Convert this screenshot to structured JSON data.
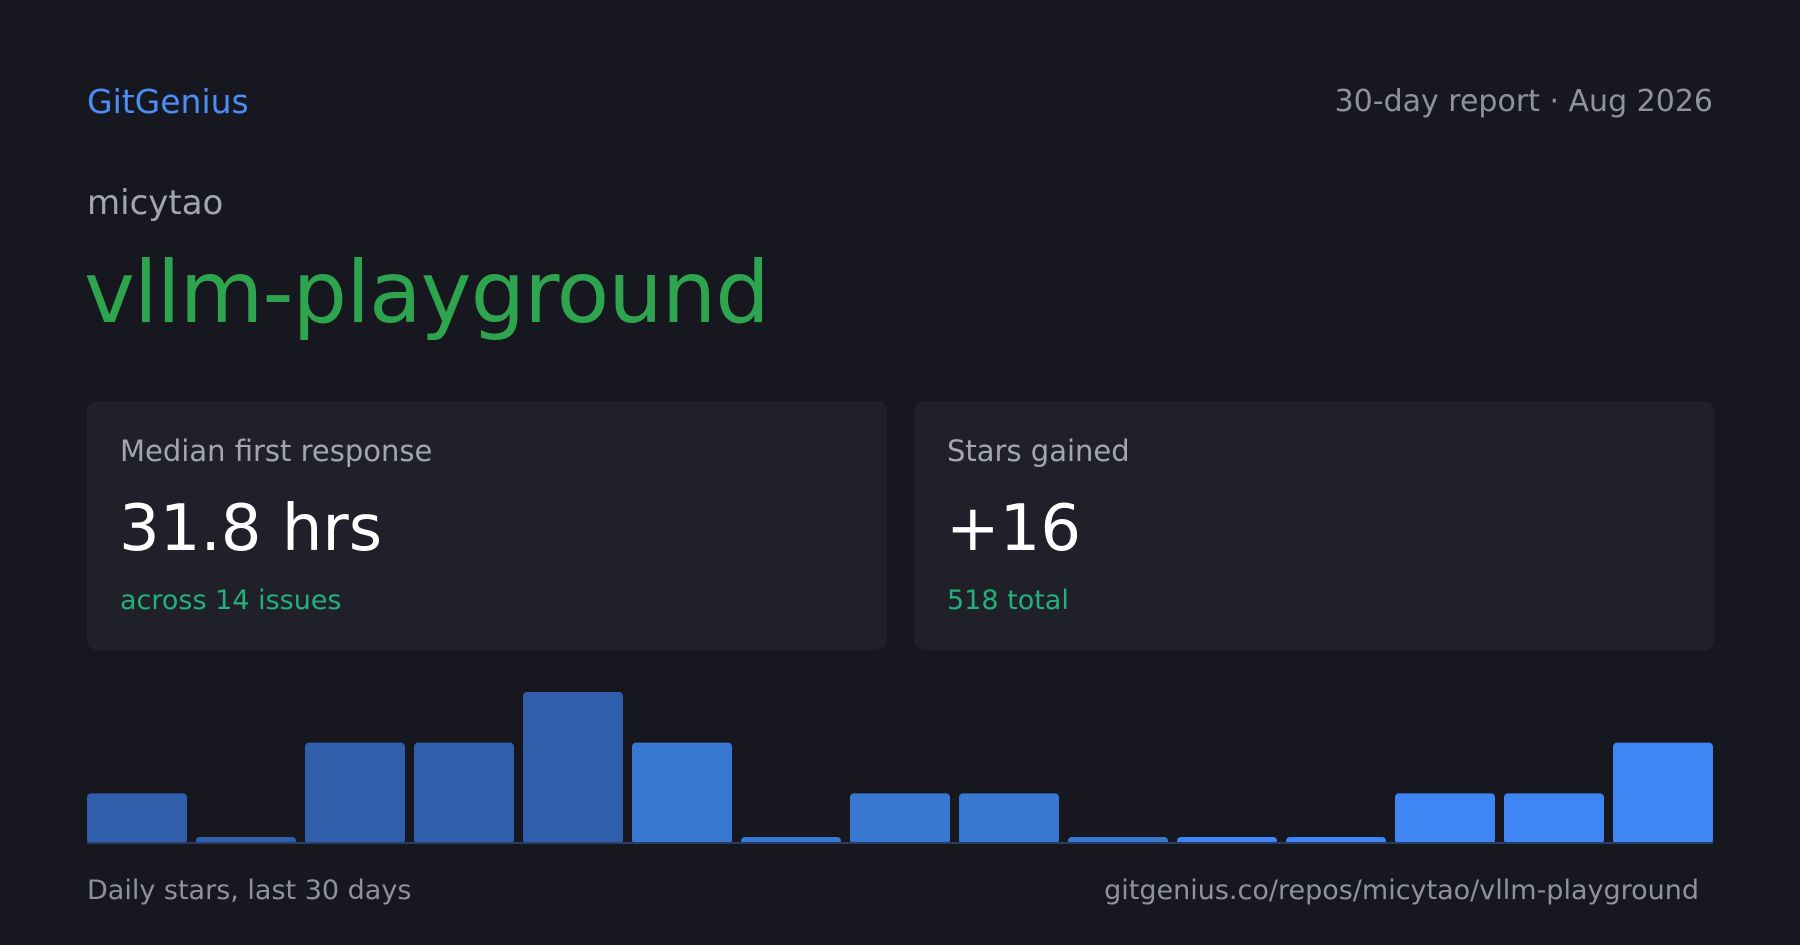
{
  "header": {
    "brand": "GitGenius",
    "report_label": "30-day report · Aug 2026"
  },
  "repo": {
    "owner": "micytao",
    "name": "vllm-playground",
    "url": "gitgenius.co/repos/micytao/vllm-playground"
  },
  "cards": [
    {
      "label": "Median first response",
      "value": "31.8 hrs",
      "note": "across 14 issues"
    },
    {
      "label": "Stars gained",
      "value": "+16",
      "note": "518 total"
    }
  ],
  "colors": {
    "brand": "#4c8df6",
    "repo_name": "#2ea44f",
    "note": "#23b07a",
    "bar_early": "#2f5faa",
    "bar_mid": "#3978d1",
    "bar_recent": "#3f86f4",
    "baseline": "#2a3d66"
  },
  "chart_data": {
    "type": "bar",
    "caption": "Daily stars, last 30 days",
    "values": [
      2,
      0.2,
      4,
      4,
      6,
      4,
      0.2,
      2,
      2,
      0.2,
      0.2,
      0.2,
      2,
      2,
      4
    ],
    "ylim": [
      0,
      6
    ],
    "grid": false,
    "legend": "none"
  }
}
